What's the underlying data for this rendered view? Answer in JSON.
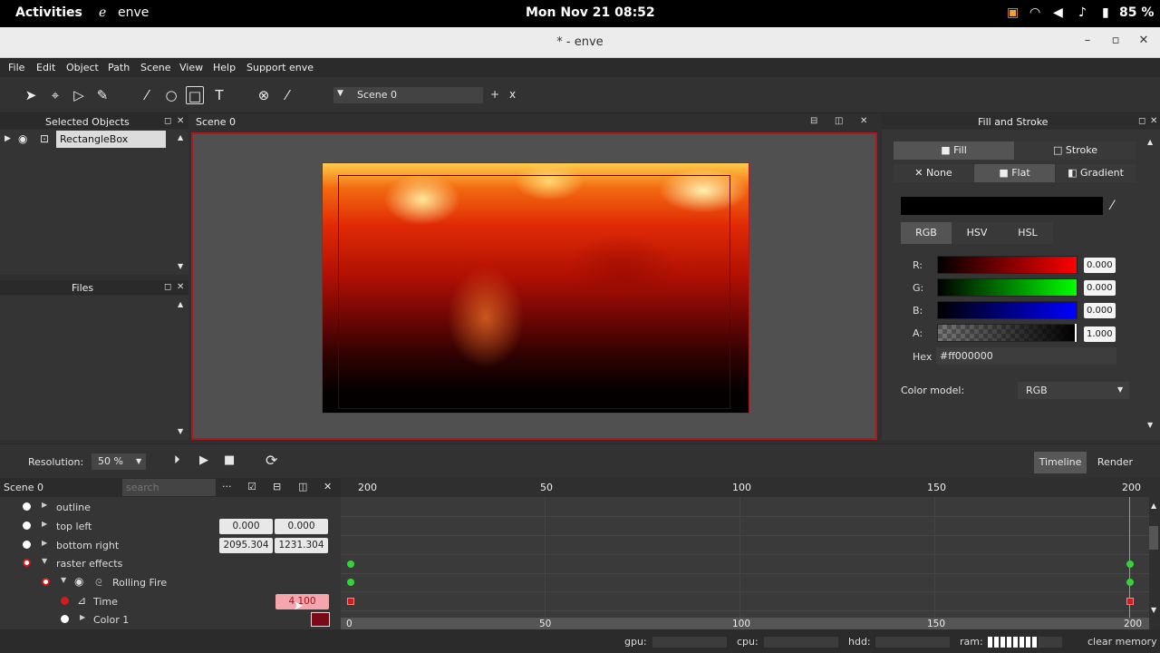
{
  "system": {
    "activities": "Activities",
    "app": "enve",
    "clock": "Mon Nov 21  08:52",
    "battery": "85 %"
  },
  "window": {
    "title": "* - enve",
    "minimize": "–",
    "maximize": "▫",
    "close": "✕"
  },
  "menu": [
    "File",
    "Edit",
    "Object",
    "Path",
    "Scene",
    "View",
    "Help",
    "Support enve"
  ],
  "toolbar": {
    "scene_name": "Scene 0",
    "add": "+",
    "remove": "x"
  },
  "selected_objects": {
    "title": "Selected Objects",
    "item": "RectangleBox"
  },
  "files": {
    "title": "Files"
  },
  "canvas": {
    "title": "Scene 0"
  },
  "fill_stroke": {
    "title": "Fill and Stroke",
    "fill": "Fill",
    "stroke": "Stroke",
    "none": "None",
    "flat": "Flat",
    "gradient": "Gradient",
    "models": [
      "RGB",
      "HSV",
      "HSL"
    ],
    "r_label": "R:",
    "g_label": "G:",
    "b_label": "B:",
    "a_label": "A:",
    "r": "0.000",
    "g": "0.000",
    "b": "0.000",
    "a": "1.000",
    "hex_label": "Hex",
    "hex": "#ff000000",
    "color_model_label": "Color model:",
    "color_model": "RGB"
  },
  "bottom": {
    "resolution_label": "Resolution:",
    "resolution": "50 %",
    "timeline": "Timeline",
    "render": "Render"
  },
  "timeline": {
    "scene": "Scene 0",
    "search_placeholder": "search",
    "more": "···",
    "rows": [
      {
        "name": "outline"
      },
      {
        "name": "top left",
        "v1": "0.000",
        "v2": "0.000"
      },
      {
        "name": "bottom right",
        "v1": "2095.304",
        "v2": "1231.304"
      },
      {
        "name": "raster effects"
      },
      {
        "name": "Rolling Fire"
      },
      {
        "name": "Time",
        "v1": "4.100"
      },
      {
        "name": "Color 1"
      }
    ],
    "ticks_top": [
      "200",
      "50",
      "100",
      "150",
      "200"
    ],
    "ticks_bottom": [
      "0",
      "50",
      "100",
      "150",
      "200"
    ]
  },
  "status": {
    "gpu": "gpu:",
    "cpu": "cpu:",
    "hdd": "hdd:",
    "ram": "ram:",
    "clear": "clear memory"
  },
  "colors": {
    "accent_red": "#b0191b",
    "keyframe_green": "#36d336",
    "keyframe_red": "#d21b1b"
  }
}
